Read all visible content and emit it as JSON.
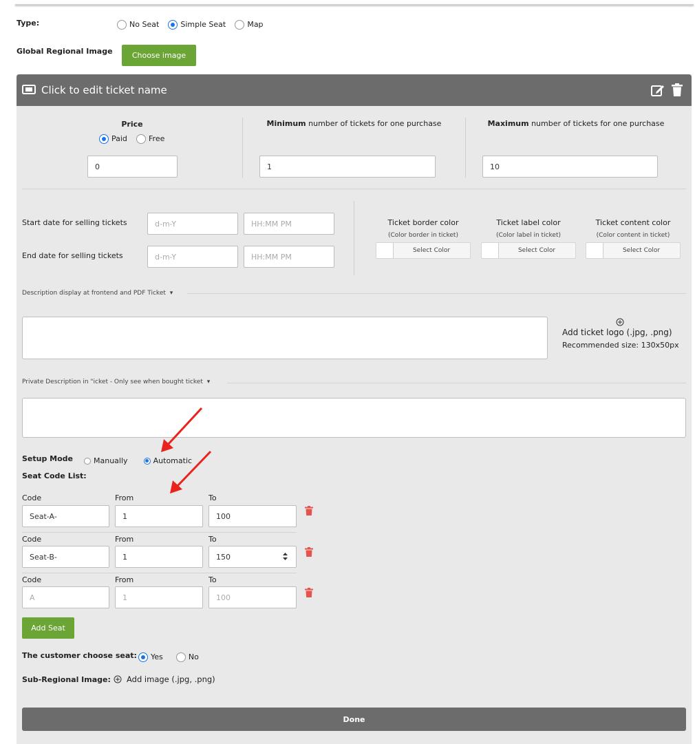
{
  "type_row": {
    "label": "Type:",
    "options": [
      "No Seat",
      "Simple Seat",
      "Map"
    ],
    "selected": "Simple Seat"
  },
  "global_image": {
    "label": "Global Regional Image",
    "button": "Choose image"
  },
  "ticket": {
    "title": "Click to edit ticket name",
    "price": {
      "label": "Price",
      "options": [
        "Paid",
        "Free"
      ],
      "selected": "Paid",
      "value": "0"
    },
    "min": {
      "bold": "Minimum",
      "rest": " number of tickets for one purchase",
      "value": "1"
    },
    "max": {
      "bold": "Maximum",
      "rest": " number of tickets for one purchase",
      "value": "10"
    },
    "start_date": {
      "label": "Start date for selling tickets",
      "date_ph": "d-m-Y",
      "time_ph": "HH:MM PM"
    },
    "end_date": {
      "label": "End date for selling tickets",
      "date_ph": "d-m-Y",
      "time_ph": "HH:MM PM"
    },
    "colors": [
      {
        "title": "Ticket border color",
        "sub": "(Color border in ticket)",
        "button": "Select Color"
      },
      {
        "title": "Ticket label color",
        "sub": "(Color label in ticket)",
        "button": "Select Color"
      },
      {
        "title": "Ticket content color",
        "sub": "(Color content in ticket)",
        "button": "Select Color"
      }
    ],
    "description_label": "Description display at frontend and PDF Ticket",
    "logo": {
      "title": "Add ticket logo (.jpg, .png)",
      "hint": "Recommended size: 130x50px"
    },
    "private_label": "Private Description in \"icket - Only see when bought ticket",
    "setup_mode": {
      "label": "Setup Mode",
      "options": [
        "Manually",
        "Automatic"
      ],
      "selected": "Automatic"
    },
    "seat_code_label": "Seat Code List:",
    "seat_headers": {
      "code": "Code",
      "from": "From",
      "to": "To"
    },
    "seats": [
      {
        "code": "Seat-A-",
        "from": "1",
        "to": "100"
      },
      {
        "code": "Seat-B-",
        "from": "1",
        "to": "150"
      },
      {
        "code_ph": "A",
        "from_ph": "1",
        "to_ph": "100"
      }
    ],
    "add_seat": "Add Seat",
    "choose_seat": {
      "label": "The customer choose seat:",
      "options": [
        "Yes",
        "No"
      ],
      "selected": "Yes"
    },
    "sub_image": {
      "label": "Sub-Regional Image:",
      "action": "Add image (.jpg, .png)"
    },
    "done": "Done"
  },
  "colors": {
    "accent_green": "#6aa535",
    "header_gray": "#6c6c6c",
    "panel_bg": "#e9e9e9",
    "radio_blue": "#1a73e8",
    "trash_red": "#e5534b",
    "arrow_red": "#e8231b"
  },
  "icons": {
    "ticket": "ticket-icon",
    "edit": "edit-icon",
    "delete": "trash-icon",
    "add": "plus-circle-icon",
    "caret": "caret-down-icon"
  }
}
